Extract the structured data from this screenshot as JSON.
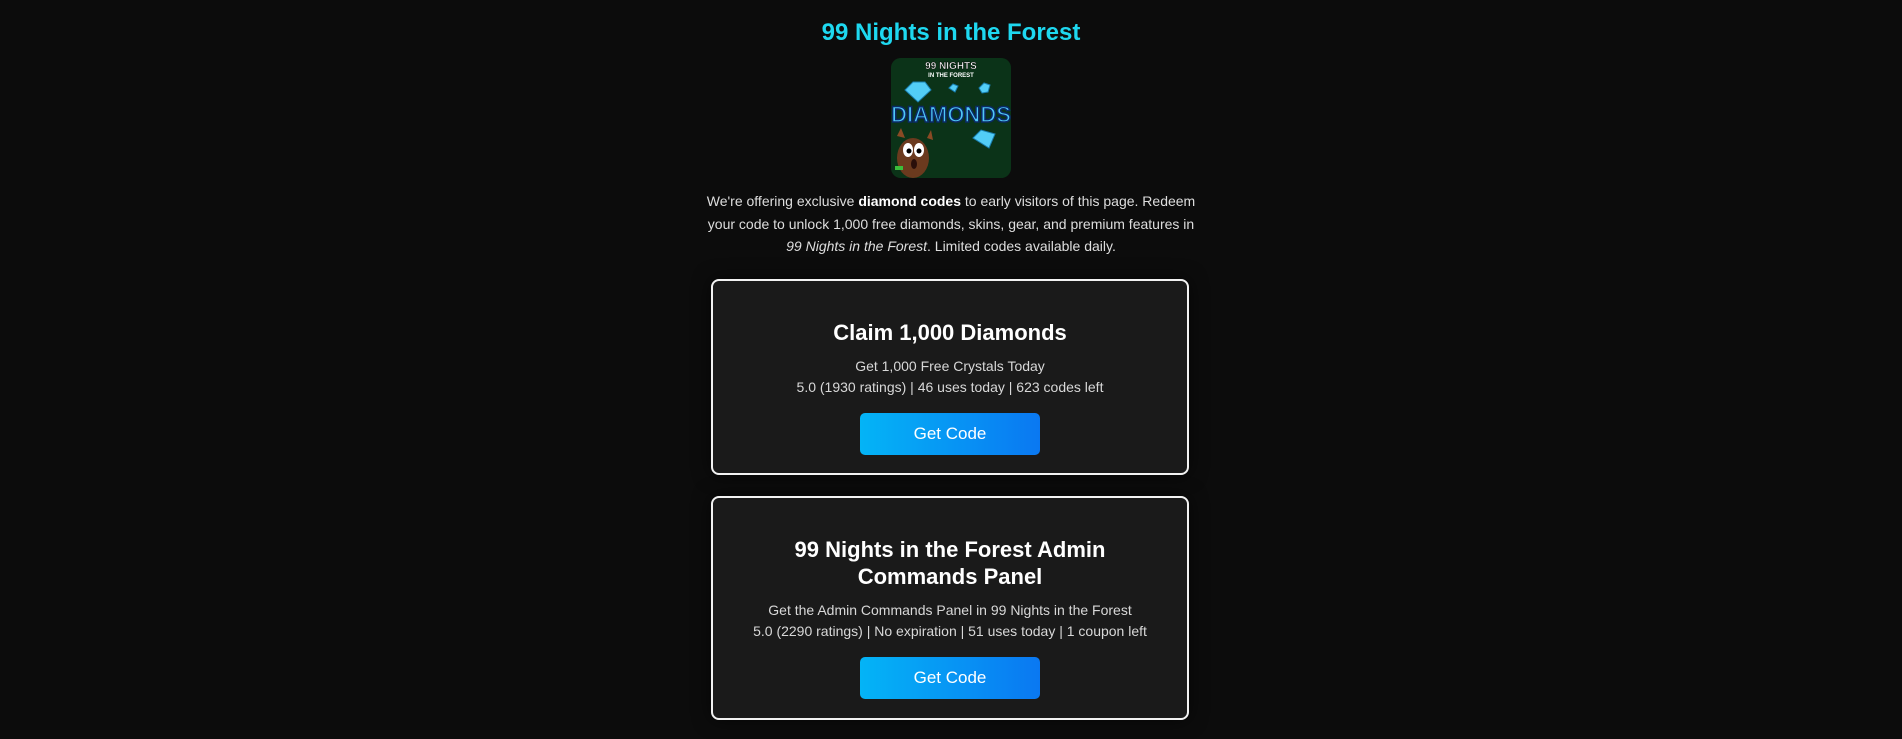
{
  "header": {
    "title": "99 Nights in the Forest",
    "logo_alt": "99 Nights in the Forest Diamonds",
    "logo_text_top": "99 NIGHTS",
    "logo_text_mid": "IN THE FOREST",
    "logo_text_main": "DIAMONDS"
  },
  "intro": {
    "part1": "We're offering exclusive ",
    "bold": "diamond codes",
    "part2": " to early visitors of this page. Redeem your code to unlock 1,000 free diamonds, skins, gear, and premium features in ",
    "italic": "99 Nights in the Forest",
    "part3": ". Limited codes available daily."
  },
  "offers": [
    {
      "title": "Claim 1,000 Diamonds",
      "subtitle": "Get 1,000 Free Crystals Today",
      "meta": "5.0 (1930 ratings) | 46 uses today | 623 codes left",
      "button": "Get Code"
    },
    {
      "title": "99 Nights in the Forest Admin Commands Panel",
      "subtitle": "Get the Admin Commands Panel in 99 Nights in the Forest",
      "meta": "5.0 (2290 ratings) | No expiration | 51 uses today | 1 coupon left",
      "button": "Get Code"
    }
  ],
  "colors": {
    "background": "#0c0c0c",
    "title": "#1ed8f0",
    "card_background": "#1a1a1a",
    "card_border": "#f2f2f2",
    "button_start": "#04b4f6",
    "button_end": "#0a78f2"
  }
}
